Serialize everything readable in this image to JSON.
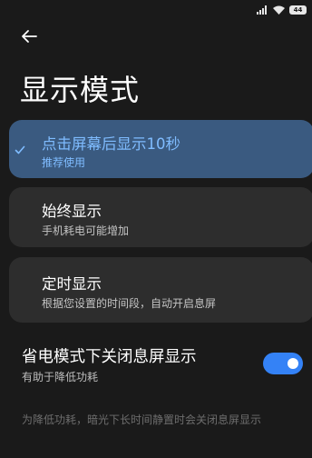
{
  "status_bar": {
    "battery": "44",
    "icons": [
      "signal-icon",
      "wifi-icon",
      "battery-icon"
    ]
  },
  "header": {
    "back_icon": "back-arrow-icon",
    "title": "显示模式"
  },
  "options": [
    {
      "title": "点击屏幕后显示10秒",
      "subtitle": "推荐使用",
      "selected": true
    },
    {
      "title": "始终显示",
      "subtitle": "手机耗电可能增加",
      "selected": false
    },
    {
      "title": "定时显示",
      "subtitle": "根据您设置的时间段，自动开启息屏",
      "selected": false
    }
  ],
  "power_saving": {
    "title": "省电模式下关闭息屏显示",
    "subtitle": "有助于降低功耗",
    "enabled": true
  },
  "footnote": "为降低功耗，暗光下长时间静置时会关闭息屏显示",
  "colors": {
    "background": "#1a1a1a",
    "card": "#2d2d2d",
    "selected_card": "#3a5a80",
    "accent": "#3482f6",
    "selected_text": "#7fbcff"
  }
}
